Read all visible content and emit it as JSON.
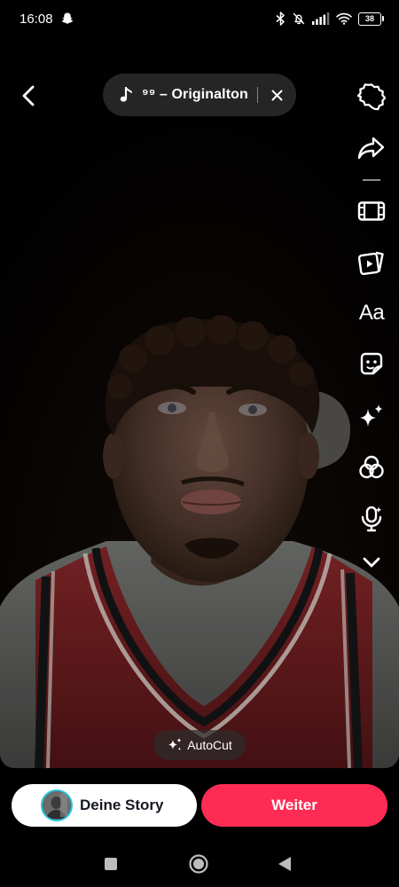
{
  "status_bar": {
    "time": "16:08",
    "notification_icon": "snapchat-ghost-icon",
    "icons": [
      "bluetooth-icon",
      "mute-icon",
      "signal-icon",
      "wifi-icon"
    ],
    "battery": "38"
  },
  "top_bar": {
    "back_icon": "chevron-left-icon",
    "sound": {
      "icon": "music-note-icon",
      "label": "⁹⁹ – Originalton",
      "remove_icon": "close-icon"
    }
  },
  "tools": [
    "settings-gear-icon",
    "share-arrow-icon",
    "film-strip-icon",
    "video-clips-icon",
    "text-tool-icon",
    "sticker-icon",
    "effects-sparkle-icon",
    "filters-icon",
    "voice-effects-icon",
    "expand-more-icon"
  ],
  "text_tool_label": "Aa",
  "autocut": {
    "icon": "sparkle-icon",
    "label": "AutoCut"
  },
  "bottom": {
    "story_label": "Deine Story",
    "next_label": "Weiter"
  },
  "colors": {
    "accent": "#fe2c55",
    "story_ring": "#25c6df"
  },
  "nav": [
    "recents-icon",
    "home-icon",
    "back-icon"
  ]
}
